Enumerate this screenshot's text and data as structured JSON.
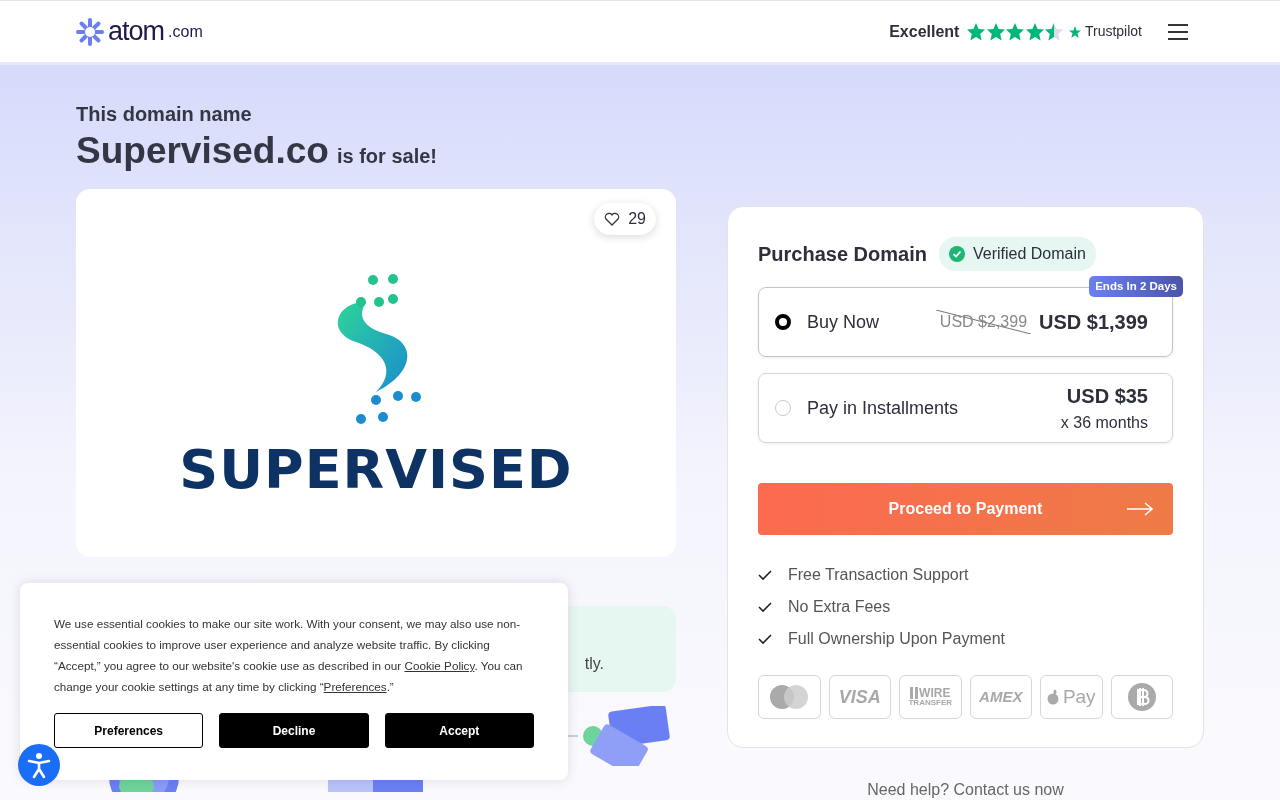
{
  "header": {
    "logo": {
      "name": "atom",
      "suffix": ".com"
    },
    "rating": {
      "label": "Excellent",
      "stars": 4.5,
      "brand": "Trustpilot"
    }
  },
  "intro": {
    "eyebrow": "This domain name",
    "domain": "Supervised.co",
    "suffix": "is for sale!"
  },
  "logo_card": {
    "likes": "29",
    "wordmark": "SUPERVISED"
  },
  "info_box": {
    "visible_text": "tly."
  },
  "purchase": {
    "title": "Purchase Domain",
    "verified": "Verified Domain",
    "options": [
      {
        "label": "Buy Now",
        "selected": true,
        "badge": "Ends In 2 Days",
        "old_price": "USD $2,399",
        "price": "USD $1,399"
      },
      {
        "label": "Pay in Installments",
        "selected": false,
        "price": "USD $35",
        "note": "x 36 months"
      }
    ],
    "cta": "Proceed to Payment",
    "features": [
      "Free Transaction Support",
      "No Extra Fees",
      "Full Ownership Upon Payment"
    ],
    "payment_methods": [
      {
        "kind": "mastercard"
      },
      {
        "kind": "visa",
        "label": "VISA"
      },
      {
        "kind": "wire",
        "label": "WIRE",
        "sub": "TRANSFER"
      },
      {
        "kind": "amex",
        "label": "AMEX"
      },
      {
        "kind": "applepay",
        "label": "Pay"
      },
      {
        "kind": "bitcoin"
      }
    ]
  },
  "help": "Need help? Contact us now",
  "cookie_banner": {
    "text": "We use essential cookies to make our site work. With your consent, we may also use non-essential cookies to improve user experience and analyze website traffic. By clicking “Accept,” you agree to our website's cookie use as described in our ",
    "policy_link": "Cookie Policy",
    "text2": ". You can change your cookie settings at any time by clicking “",
    "pref_link": "Preferences",
    "text3": ".”",
    "buttons": [
      {
        "label": "Preferences",
        "kind": "outline"
      },
      {
        "label": "Decline",
        "kind": "dark"
      },
      {
        "label": "Accept",
        "kind": "dark"
      }
    ]
  }
}
